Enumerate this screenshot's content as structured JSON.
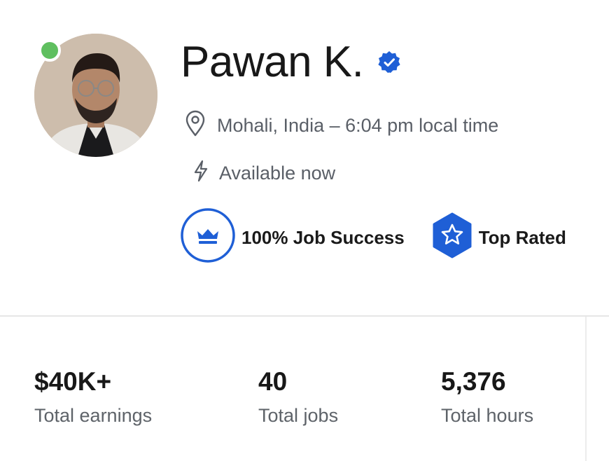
{
  "profile": {
    "name": "Pawan K.",
    "location_line": "Mohali, India – 6:04 pm local time",
    "availability": "Available now",
    "online": true
  },
  "badges": {
    "job_success": "100% Job Success",
    "top_rated": "Top Rated"
  },
  "stats": [
    {
      "value": "$40K+",
      "label": "Total earnings"
    },
    {
      "value": "40",
      "label": "Total jobs"
    },
    {
      "value": "5,376",
      "label": "Total hours"
    }
  ],
  "icons": {
    "verified": "verified-badge-icon",
    "location": "map-pin-icon",
    "availability": "lightning-icon",
    "job_success": "crown-icon",
    "top_rated": "star-hexagon-icon"
  },
  "colors": {
    "accent_blue": "#1f5fd6",
    "online_green": "#5fbf5f",
    "muted_text": "#5a5f67"
  }
}
